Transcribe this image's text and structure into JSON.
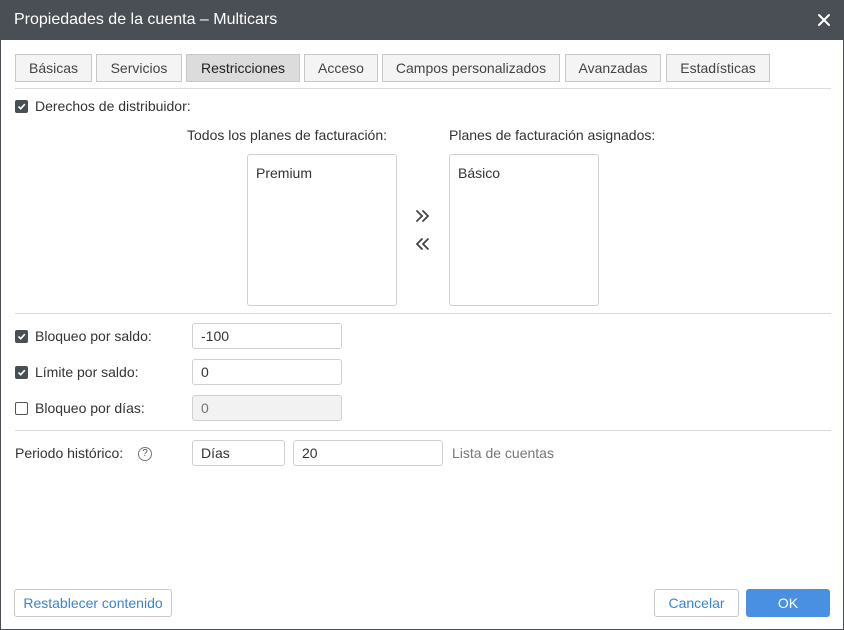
{
  "window": {
    "title": "Propiedades de la cuenta – Multicars"
  },
  "icons": {
    "close": "close-icon",
    "checkmark": "checkmark-icon",
    "help": "help-circle-icon",
    "move_right": "double-chevron-right-icon",
    "move_left": "double-chevron-left-icon"
  },
  "tabs": [
    {
      "label": "Básicas",
      "active": false
    },
    {
      "label": "Servicios",
      "active": false
    },
    {
      "label": "Restricciones",
      "active": true
    },
    {
      "label": "Acceso",
      "active": false
    },
    {
      "label": "Campos personalizados",
      "active": false
    },
    {
      "label": "Avanzadas",
      "active": false
    },
    {
      "label": "Estadísticas",
      "active": false
    }
  ],
  "distributor": {
    "label": "Derechos de distribuidor:",
    "checked": true,
    "all_plans_label": "Todos los planes de facturación:",
    "assigned_plans_label": "Planes de facturación asignados:",
    "all_plans": [
      "Premium"
    ],
    "assigned_plans": [
      "Básico"
    ],
    "move_right_glyph": "»",
    "move_left_glyph": "«"
  },
  "restrictions": {
    "balance_block": {
      "label": "Bloqueo por saldo:",
      "checked": true,
      "value": "-100"
    },
    "balance_limit": {
      "label": "Límite por saldo:",
      "checked": true,
      "value": "0"
    },
    "days_block": {
      "label": "Bloqueo por días:",
      "checked": false,
      "placeholder": "0"
    }
  },
  "history": {
    "label": "Periodo histórico:",
    "help_glyph": "?",
    "unit": "Días",
    "value": "20",
    "link": "Lista de cuentas"
  },
  "footer": {
    "reset": "Restablecer contenido",
    "cancel": "Cancelar",
    "ok": "OK"
  },
  "colors": {
    "titlebar": "#4a4f55",
    "accent": "#4a90e2",
    "link": "#3b84d4"
  }
}
